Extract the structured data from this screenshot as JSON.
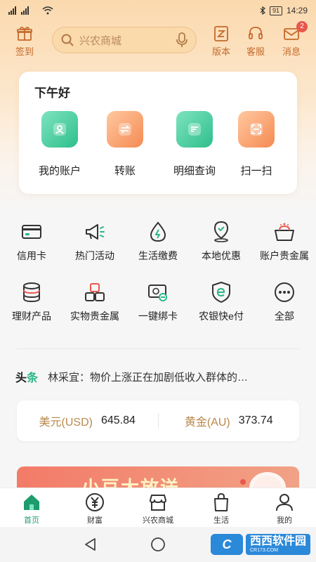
{
  "status_bar": {
    "time": "14:29",
    "battery": "91"
  },
  "header": {
    "checkin_label": "签到",
    "search_placeholder": "兴农商城",
    "version_label": "版本",
    "service_label": "客服",
    "message_label": "消息",
    "message_badge": "2"
  },
  "greeting": {
    "text": "下午好",
    "actions": [
      {
        "label": "我的账户",
        "icon": "user-account-icon"
      },
      {
        "label": "转账",
        "icon": "transfer-icon"
      },
      {
        "label": "明细查询",
        "icon": "details-query-icon"
      },
      {
        "label": "扫一扫",
        "icon": "scan-icon"
      }
    ]
  },
  "services": [
    {
      "label": "信用卡",
      "icon": "credit-card-icon"
    },
    {
      "label": "热门活动",
      "icon": "megaphone-icon"
    },
    {
      "label": "生活缴费",
      "icon": "utility-payment-icon"
    },
    {
      "label": "本地优惠",
      "icon": "location-discount-icon"
    },
    {
      "label": "账户贵金属",
      "icon": "precious-metal-basket-icon"
    },
    {
      "label": "理财产品",
      "icon": "coins-stack-icon"
    },
    {
      "label": "实物贵金属",
      "icon": "gold-bars-icon"
    },
    {
      "label": "一键绑卡",
      "icon": "bind-card-icon"
    },
    {
      "label": "农银快e付",
      "icon": "e-pay-shield-icon"
    },
    {
      "label": "全部",
      "icon": "more-dots-icon"
    }
  ],
  "headline": {
    "tag_part1": "头",
    "tag_part2": "条",
    "text": "林采宜：物价上涨正在加剧低收入群体的…"
  },
  "rates": [
    {
      "name": "美元(USD)",
      "value": "645.84"
    },
    {
      "name": "黄金(AU)",
      "value": "373.74"
    }
  ],
  "banner": {
    "text": "小豆大放送"
  },
  "tabs": [
    {
      "label": "首页",
      "icon": "home-icon",
      "active": true
    },
    {
      "label": "财富",
      "icon": "yuan-coin-icon",
      "active": false
    },
    {
      "label": "兴农商城",
      "icon": "shop-icon",
      "active": false
    },
    {
      "label": "生活",
      "icon": "shopping-bag-icon",
      "active": false
    },
    {
      "label": "我的",
      "icon": "profile-icon",
      "active": false
    }
  ],
  "watermark": {
    "logo": "C",
    "text": "西西软件园",
    "sub": "CR173.COM"
  },
  "colors": {
    "accent_green": "#1e9c6e",
    "accent_orange": "#c4692a",
    "gold_text": "#b9894c"
  }
}
